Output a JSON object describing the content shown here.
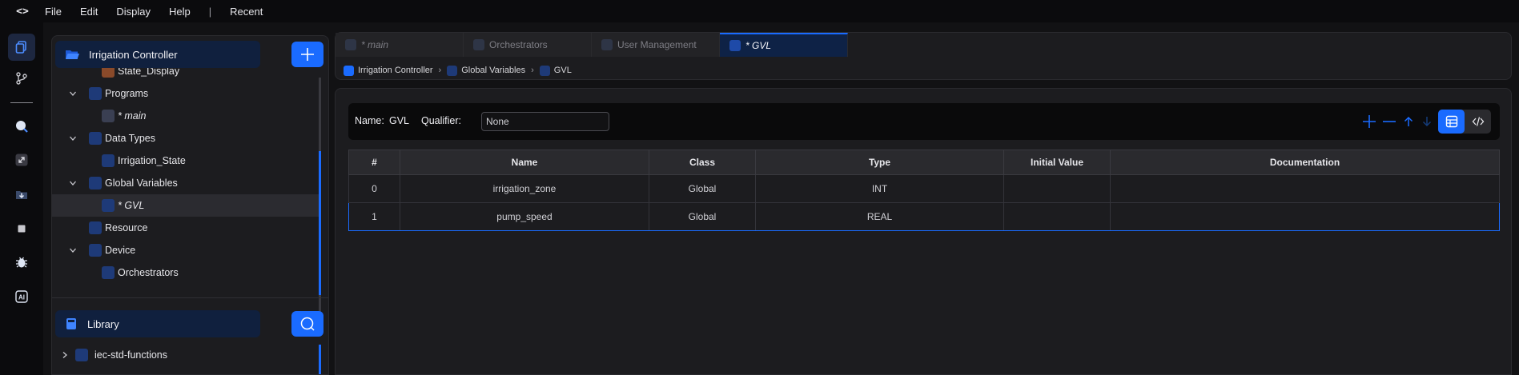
{
  "menu": {
    "logo": "<>",
    "items": [
      "File",
      "Edit",
      "Display",
      "Help"
    ],
    "separator": "|",
    "recent": "Recent"
  },
  "rail": {
    "icons": [
      "files-icon",
      "source-control-icon",
      "search-icon",
      "expand-icon",
      "download-icon",
      "stop-icon",
      "debug-icon",
      "ai-icon"
    ],
    "ai_label": "AI"
  },
  "explorer": {
    "project_title": "Irrigation Controller",
    "tree": [
      {
        "label": "State_Display",
        "indent": 3,
        "chevron": false,
        "icon": "function-block-icon",
        "italic": false
      },
      {
        "label": "Programs",
        "indent": 2,
        "chevron": true,
        "icon": "programs-icon",
        "italic": false
      },
      {
        "label": "* main",
        "indent": 3,
        "chevron": false,
        "icon": "program-file-icon",
        "italic": true
      },
      {
        "label": "Data Types",
        "indent": 2,
        "chevron": true,
        "icon": "data-types-icon",
        "italic": false
      },
      {
        "label": "Irrigation_State",
        "indent": 3,
        "chevron": false,
        "icon": "data-type-file-icon",
        "italic": false
      },
      {
        "label": "Global Variables",
        "indent": 2,
        "chevron": true,
        "icon": "global-variables-icon",
        "italic": false
      },
      {
        "label": "* GVL",
        "indent": 3,
        "chevron": false,
        "icon": "gvl-file-icon",
        "italic": true,
        "selected": true
      },
      {
        "label": "Resource",
        "indent": 2,
        "chevron": false,
        "icon": "resource-icon",
        "italic": false
      },
      {
        "label": "Device",
        "indent": 2,
        "chevron": true,
        "icon": "device-icon",
        "italic": false
      },
      {
        "label": "Orchestrators",
        "indent": 3,
        "chevron": false,
        "icon": "orchestrators-icon",
        "italic": false
      }
    ],
    "library_title": "Library",
    "library_items": [
      {
        "label": "iec-std-functions"
      }
    ]
  },
  "tabs": [
    {
      "label": "* main",
      "italic": true,
      "active": false,
      "icon": "program-file-icon"
    },
    {
      "label": "Orchestrators",
      "italic": false,
      "active": false,
      "icon": "orchestrators-icon"
    },
    {
      "label": "User Management",
      "italic": false,
      "active": false,
      "icon": "users-icon"
    },
    {
      "label": "* GVL",
      "italic": true,
      "active": true,
      "icon": "gvl-file-icon"
    }
  ],
  "breadcrumb": [
    "Irrigation Controller",
    "Global Variables",
    "GVL"
  ],
  "editor": {
    "name_label": "Name:",
    "name_value": "GVL",
    "qualifier_label": "Qualifier:",
    "qualifier_value": "None"
  },
  "table": {
    "columns": [
      "#",
      "Name",
      "Class",
      "Type",
      "Initial Value",
      "Documentation"
    ],
    "rows": [
      [
        "0",
        "irrigation_zone",
        "Global",
        "INT",
        "",
        ""
      ],
      [
        "1",
        "pump_speed",
        "Global",
        "REAL",
        "",
        ""
      ]
    ],
    "selected_row": 1
  },
  "colors": {
    "accent": "#1a6bff",
    "panel": "#1c1c1f",
    "background": "#121214"
  }
}
